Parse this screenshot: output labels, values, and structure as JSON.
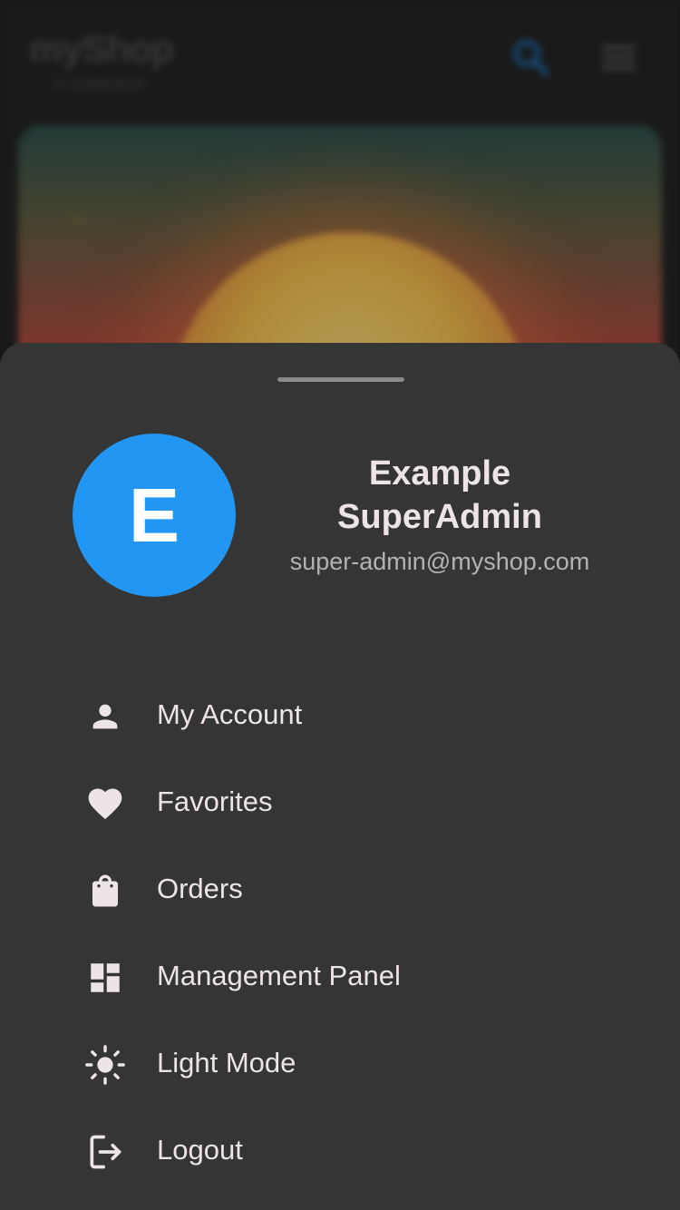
{
  "background": {
    "logo_title": "myShop",
    "logo_subtitle": "e-commerce",
    "icons": [
      "search-icon",
      "hamburger-menu-icon"
    ]
  },
  "sheet": {
    "avatar_letter": "E",
    "user_name": "Example SuperAdmin",
    "user_email": "super-admin@myshop.com",
    "menu": [
      {
        "label": "My Account",
        "icon": "person-icon"
      },
      {
        "label": "Favorites",
        "icon": "heart-icon"
      },
      {
        "label": "Orders",
        "icon": "shopping-bag-icon"
      },
      {
        "label": "Management Panel",
        "icon": "dashboard-icon"
      },
      {
        "label": "Light Mode",
        "icon": "sun-icon"
      },
      {
        "label": "Logout",
        "icon": "logout-icon"
      }
    ]
  },
  "colors": {
    "accent": "#2196f3",
    "sheet_background": "#353535",
    "text_primary": "#ece4e6",
    "text_secondary": "#b3b3b3"
  }
}
